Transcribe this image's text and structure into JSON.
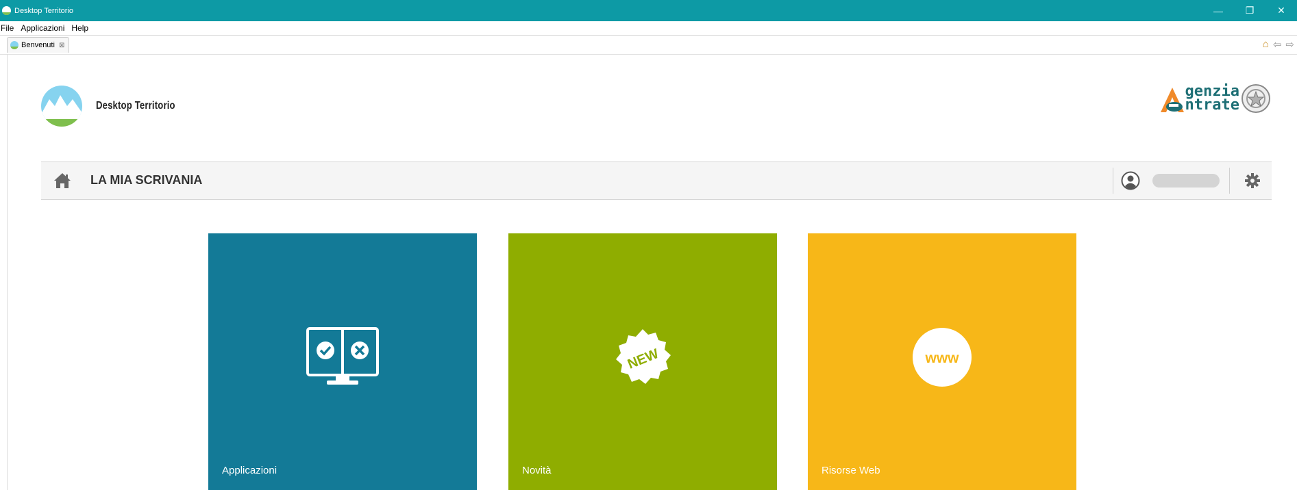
{
  "window": {
    "title": "Desktop Territorio"
  },
  "menu": {
    "items": [
      "File",
      "Applicazioni",
      "Help"
    ]
  },
  "tabs": [
    {
      "label": "Benvenuti",
      "close": "⊠"
    }
  ],
  "header": {
    "app_name": "Desktop Territorio",
    "agency_line1": "genzia",
    "agency_line2": "ntrate"
  },
  "toolbar": {
    "title": "LA MIA SCRIVANIA",
    "user_name": ""
  },
  "tiles": [
    {
      "label": "Applicazioni",
      "color": "#137a97",
      "icon": "monitor-check-cross-icon"
    },
    {
      "label": "Novità",
      "color": "#8fad00",
      "icon": "new-badge-icon",
      "badge": "NEW"
    },
    {
      "label": "Risorse Web",
      "color": "#f7b718",
      "icon": "www-icon",
      "badge": "www"
    }
  ],
  "colors": {
    "titlebar": "#0d9aa5",
    "agency_text": "#1e6f75",
    "agency_accent": "#f08a2a"
  }
}
